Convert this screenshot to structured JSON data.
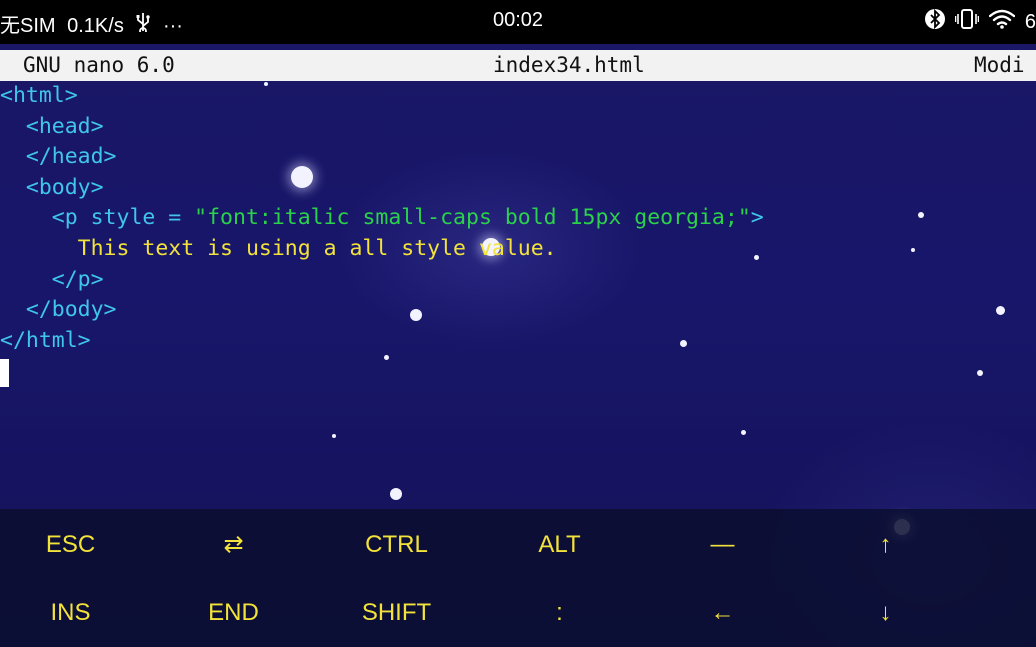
{
  "status_bar": {
    "carrier": "无SIM",
    "speed": "0.1K/s",
    "usb_icon": "usb-icon",
    "more": "···",
    "time": "00:02",
    "bluetooth_icon": "bluetooth-icon",
    "vibrate_icon": "vibrate-icon",
    "wifi_icon": "wifi-icon",
    "battery_partial": "6"
  },
  "nano": {
    "version": "GNU nano 6.0",
    "filename": "index34.html",
    "state": "Modi"
  },
  "editor_lines": [
    {
      "indent": "",
      "segments": [
        {
          "cls": "tag",
          "text": "<html>"
        }
      ]
    },
    {
      "indent": "  ",
      "segments": [
        {
          "cls": "tag",
          "text": "<head>"
        }
      ]
    },
    {
      "indent": "  ",
      "segments": [
        {
          "cls": "tag",
          "text": "</head>"
        }
      ]
    },
    {
      "indent": "  ",
      "segments": [
        {
          "cls": "tag",
          "text": "<body>"
        }
      ]
    },
    {
      "indent": "    ",
      "segments": [
        {
          "cls": "tag",
          "text": "<p style = "
        },
        {
          "cls": "attr-val",
          "text": "\"font:italic small-caps bold 15px georgia;\""
        },
        {
          "cls": "tag",
          "text": ">"
        }
      ]
    },
    {
      "indent": "      ",
      "segments": [
        {
          "cls": "plain",
          "text": "This text is using a all style value."
        }
      ]
    },
    {
      "indent": "    ",
      "segments": [
        {
          "cls": "tag",
          "text": "</p>"
        }
      ]
    },
    {
      "indent": "  ",
      "segments": [
        {
          "cls": "tag",
          "text": "</body>"
        }
      ]
    },
    {
      "indent": "",
      "segments": [
        {
          "cls": "tag",
          "text": "</html>"
        }
      ]
    }
  ],
  "extra_keys": {
    "row1": [
      "ESC",
      "⇄",
      "CTRL",
      "ALT",
      "—",
      "↑"
    ],
    "row2": [
      "INS",
      "END",
      "SHIFT",
      ":",
      "←",
      "↓"
    ]
  },
  "colors": {
    "tag": "#3fc6e8",
    "attr_value": "#2bd14a",
    "text": "#f2e23a",
    "background": "#17155f"
  }
}
